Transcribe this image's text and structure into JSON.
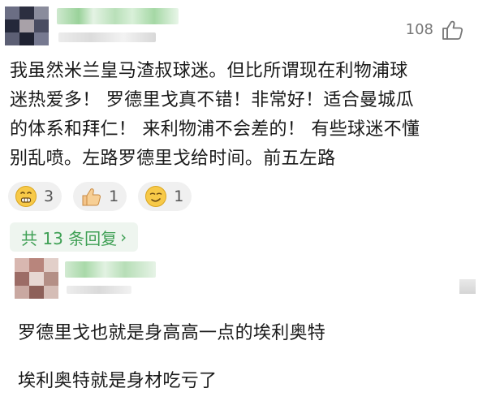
{
  "comment": {
    "like_count": "108",
    "lines": [
      "我虽然米兰皇马渣叔球迷。但比所谓现在利物浦球",
      "迷热爱多！ 罗德里戈真不错！非常好！适合曼城瓜",
      "的体系和拜仁！ 来利物浦不会差的！ 有些球迷不懂",
      "别乱喷。左路罗德里戈给时间。前五左路"
    ],
    "reactions": [
      {
        "icon": "grimace-emoji-icon",
        "count": "3"
      },
      {
        "icon": "thumbs-up-icon",
        "count": "1"
      },
      {
        "icon": "smirk-emoji-icon",
        "count": "1"
      }
    ],
    "replies_label": "共 13 条回复",
    "replies_chevron": "chevron-right-icon"
  },
  "reply": {
    "lines": [
      "罗德里戈也就是身高高一点的埃利奥特",
      "埃利奥特就是身材吃亏了"
    ]
  },
  "colors": {
    "accent_green": "#3fa055",
    "pill_bg": "#eef5ef",
    "reaction_bg": "#f0f0f0",
    "meta_gray": "#777777"
  }
}
